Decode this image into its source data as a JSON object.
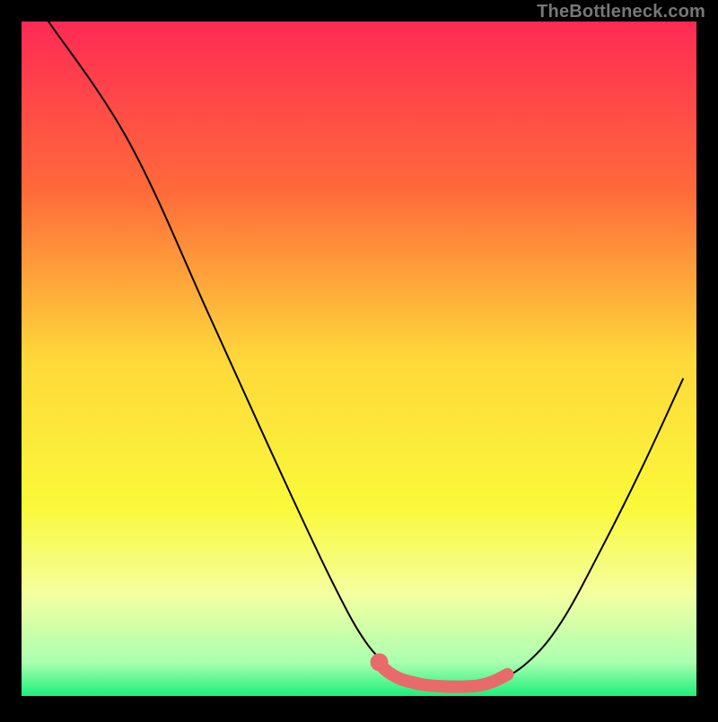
{
  "watermark_text": "TheBottleneck.com",
  "chart_data": {
    "type": "line",
    "title": "",
    "xlabel": "",
    "ylabel": "",
    "xlim": [
      0,
      100
    ],
    "ylim": [
      0,
      100
    ],
    "background_gradient_stops": [
      {
        "t": 0.0,
        "color": "#ff2a55"
      },
      {
        "t": 0.25,
        "color": "#ff6a3a"
      },
      {
        "t": 0.5,
        "color": "#ffd83a"
      },
      {
        "t": 0.72,
        "color": "#faf93a"
      },
      {
        "t": 0.85,
        "color": "#f4ffa0"
      },
      {
        "t": 0.95,
        "color": "#aaffb0"
      },
      {
        "t": 1.0,
        "color": "#1cf07a"
      }
    ],
    "series": [
      {
        "name": "v-curve",
        "color": "#000000",
        "width": 2,
        "values_xy": [
          [
            4,
            100
          ],
          [
            16,
            82
          ],
          [
            28,
            56
          ],
          [
            38,
            34
          ],
          [
            46,
            17
          ],
          [
            51,
            8
          ],
          [
            55,
            4
          ],
          [
            58,
            2
          ],
          [
            62,
            1.3
          ],
          [
            66,
            1.3
          ],
          [
            70,
            2
          ],
          [
            75,
            5
          ],
          [
            80,
            11
          ],
          [
            86,
            22
          ],
          [
            92,
            34
          ],
          [
            98,
            47
          ]
        ]
      },
      {
        "name": "highlight-band",
        "color": "#e96a6a",
        "width": 14,
        "values_xy": [
          [
            53,
            5.0
          ],
          [
            54,
            3.8
          ],
          [
            56,
            2.6
          ],
          [
            58,
            2.0
          ],
          [
            60,
            1.6
          ],
          [
            63,
            1.4
          ],
          [
            66,
            1.4
          ],
          [
            68,
            1.6
          ],
          [
            70,
            2.2
          ],
          [
            72,
            3.2
          ]
        ]
      }
    ],
    "dots": [
      {
        "x": 53,
        "y": 5.0,
        "r": 10,
        "color": "#e96a6a"
      }
    ]
  }
}
